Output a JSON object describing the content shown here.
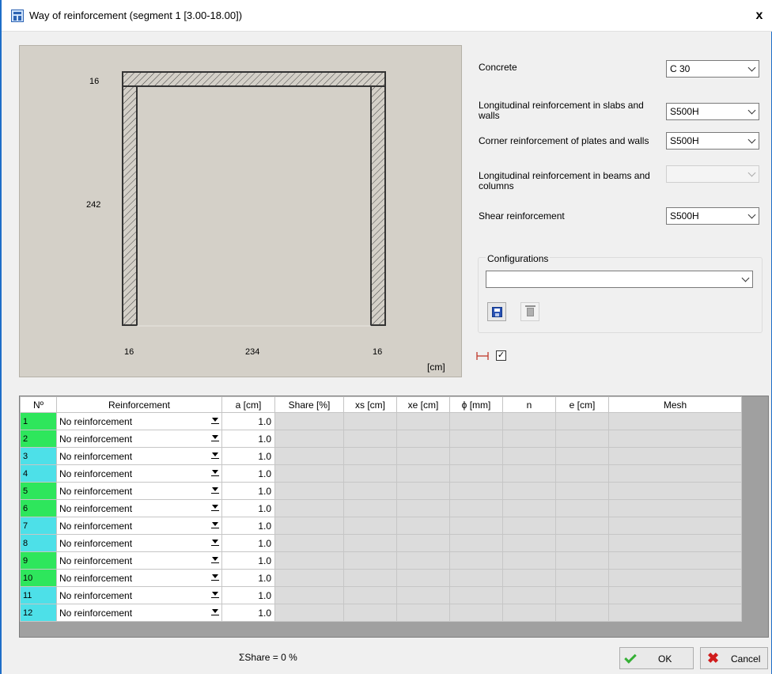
{
  "window": {
    "title": "Way of reinforcement (segment 1 [3.00-18.00])",
    "close_glyph": "x"
  },
  "preview": {
    "dim_top": "16",
    "dim_left": "242",
    "dim_bottom_left": "16",
    "dim_bottom_mid": "234",
    "dim_bottom_right": "16",
    "unit": "[cm]"
  },
  "props": {
    "concrete_label": "Concrete",
    "concrete_value": "C 30",
    "long_slabs_label": "Longitudinal reinforcement in slabs and walls",
    "long_slabs_value": "S500H",
    "corner_label": "Corner reinforcement of plates and walls",
    "corner_value": "S500H",
    "long_beams_label": "Longitudinal reinforcement in beams and columns",
    "long_beams_value": "",
    "shear_label": "Shear reinforcement",
    "shear_value": "S500H"
  },
  "configurations": {
    "label": "Configurations",
    "value": ""
  },
  "show_dimensions_checked": "✓",
  "table": {
    "headers": [
      "Nº",
      "Reinforcement",
      "a [cm]",
      "Share [%]",
      "xs [cm]",
      "xe [cm]",
      "ϕ [mm]",
      "n",
      "e [cm]",
      "Mesh"
    ],
    "rows": [
      {
        "n": "1",
        "color": "green",
        "reinforcement": "No reinforcement",
        "a": "1.0"
      },
      {
        "n": "2",
        "color": "green",
        "reinforcement": "No reinforcement",
        "a": "1.0"
      },
      {
        "n": "3",
        "color": "cyan",
        "reinforcement": "No reinforcement",
        "a": "1.0"
      },
      {
        "n": "4",
        "color": "cyan",
        "reinforcement": "No reinforcement",
        "a": "1.0"
      },
      {
        "n": "5",
        "color": "green",
        "reinforcement": "No reinforcement",
        "a": "1.0"
      },
      {
        "n": "6",
        "color": "green",
        "reinforcement": "No reinforcement",
        "a": "1.0"
      },
      {
        "n": "7",
        "color": "cyan",
        "reinforcement": "No reinforcement",
        "a": "1.0"
      },
      {
        "n": "8",
        "color": "cyan",
        "reinforcement": "No reinforcement",
        "a": "1.0"
      },
      {
        "n": "9",
        "color": "green",
        "reinforcement": "No reinforcement",
        "a": "1.0"
      },
      {
        "n": "10",
        "color": "green",
        "reinforcement": "No reinforcement",
        "a": "1.0"
      },
      {
        "n": "11",
        "color": "cyan",
        "reinforcement": "No reinforcement",
        "a": "1.0"
      },
      {
        "n": "12",
        "color": "cyan",
        "reinforcement": "No reinforcement",
        "a": "1.0"
      }
    ]
  },
  "footer": {
    "share_total": "ΣShare = 0 %",
    "ok_label": "OK",
    "cancel_label": "Cancel"
  },
  "colors": {
    "green": "#2ee65c",
    "cyan": "#4de0e8",
    "titlebar_border": "#1e6ec8"
  },
  "icons": [
    "app-icon",
    "close-icon",
    "save-icon",
    "trash-icon",
    "dimension-toggle-icon",
    "check-icon",
    "ok-check-icon",
    "cancel-x-icon"
  ]
}
